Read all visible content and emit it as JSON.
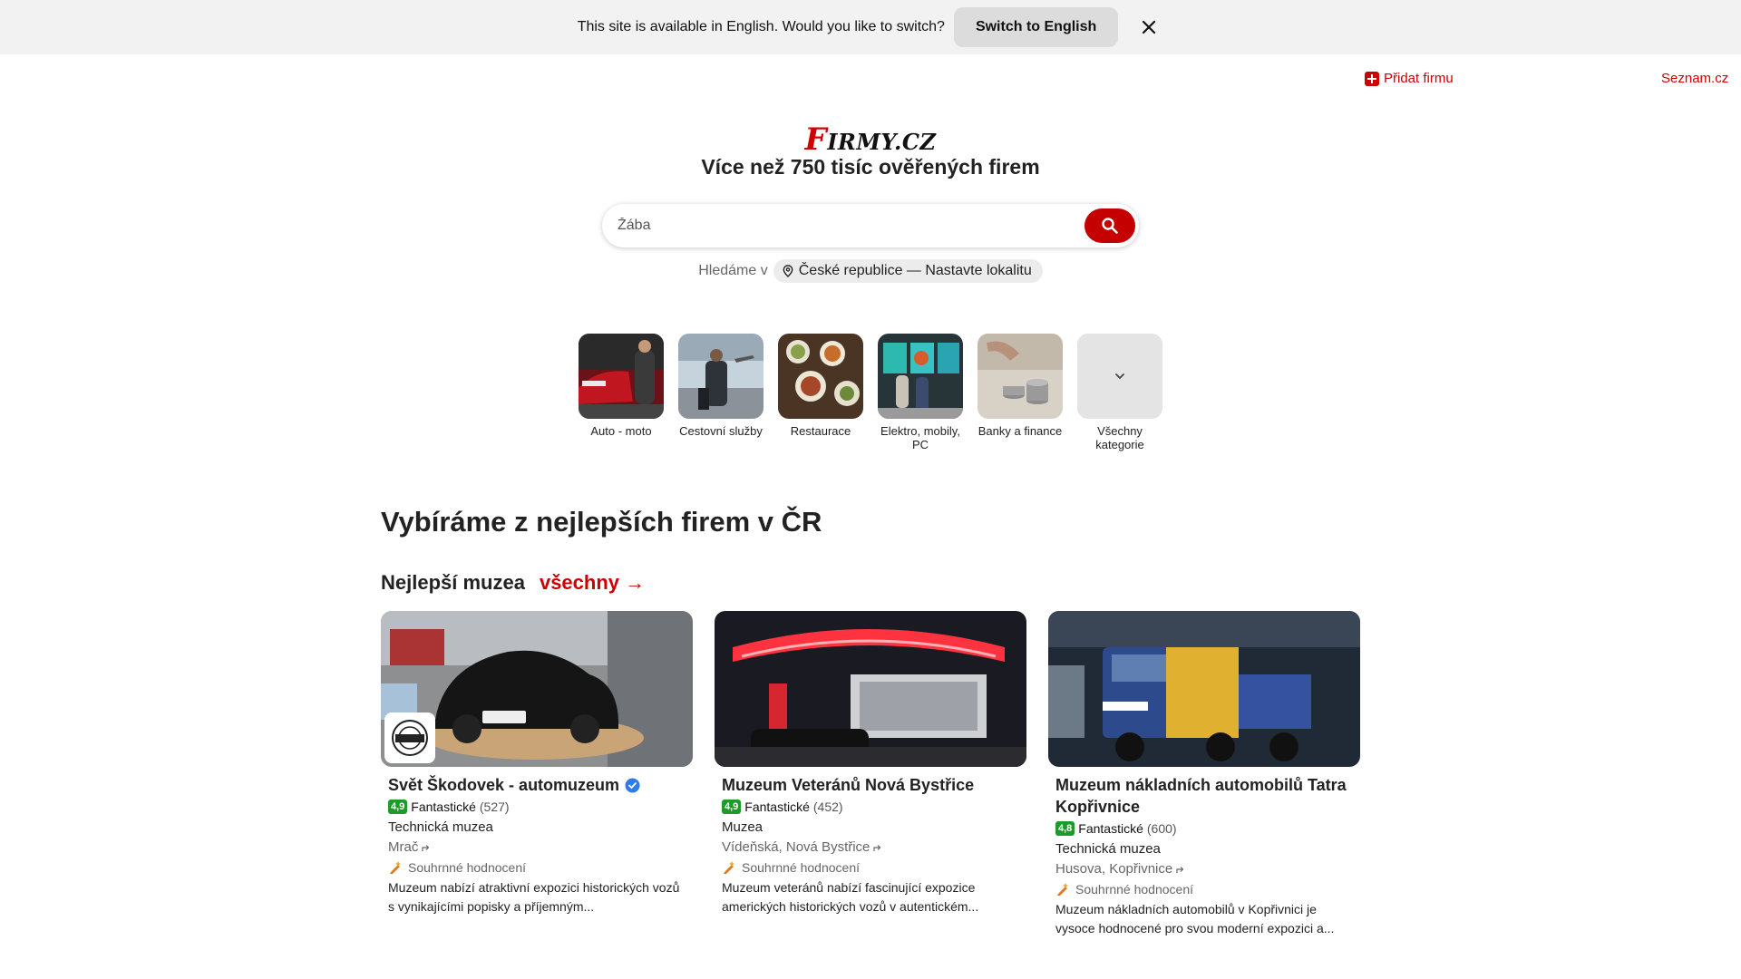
{
  "banner": {
    "message": "This site is available in English. Would you like to switch?",
    "switch_label": "Switch to English",
    "close_icon": "close-icon"
  },
  "top": {
    "add_firm": "Přidat firmu",
    "seznam": "Seznam.cz"
  },
  "brand": {
    "logo_first": "F",
    "logo_rest": "IRMY.CZ",
    "headline": "Více než 750 tisíc ověřených firem"
  },
  "search": {
    "placeholder": "Žába",
    "button_icon": "search-icon"
  },
  "locality": {
    "label": "Hledáme v",
    "value": "České republice — Nastavte lokalitu",
    "icon": "location-pin-icon"
  },
  "categories": [
    {
      "label": "Auto - moto"
    },
    {
      "label": "Cestovní služby"
    },
    {
      "label": "Restaurace"
    },
    {
      "label": "Elektro, mobily, PC"
    },
    {
      "label": "Banky a finance"
    },
    {
      "label": "Všechny kategorie"
    }
  ],
  "section": {
    "title": "Vybíráme z nejlepších firem v ČR",
    "subtitle": "Nejlepší muzea",
    "all_link": "všechny →"
  },
  "cards": [
    {
      "title": "Svět Škodovek - automuzeum",
      "verified": true,
      "score": "4,9",
      "rating_label": "Fantastické",
      "count": "(527)",
      "category": "Technická muzea",
      "address": "Mrač",
      "summary": "Souhrnné hodnocení",
      "description": "Muzeum nabízí atraktivní expozici historických vozů s vynikajícími popisky a příjemným..."
    },
    {
      "title": "Muzeum Veteránů Nová Bystřice",
      "verified": false,
      "score": "4,9",
      "rating_label": "Fantastické",
      "count": "(452)",
      "category": "Muzea",
      "address": "Vídeňská, Nová Bystřice",
      "summary": "Souhrnné hodnocení",
      "description": "Muzeum veteránů nabízí fascinující expozice amerických historických vozů v autentickém..."
    },
    {
      "title": "Muzeum nákladních automobilů Tatra Kopřivnice",
      "verified": false,
      "score": "4,8",
      "rating_label": "Fantastické",
      "count": "(600)",
      "category": "Technická muzea",
      "address": "Husova, Kopřivnice",
      "summary": "Souhrnné hodnocení",
      "description": "Muzeum nákladních automobilů v Kopřivnici je vysoce hodnocené pro svou moderní expozici a..."
    }
  ],
  "colors": {
    "brand_red": "#c40000",
    "rating_green": "#1e9a2a",
    "banner_bg": "#f2f2f2"
  }
}
